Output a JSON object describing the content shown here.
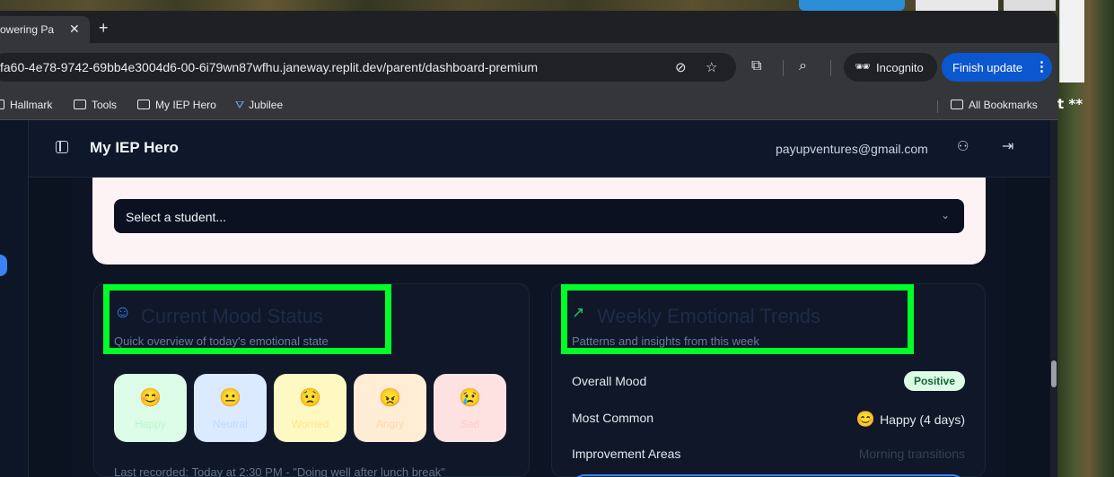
{
  "desktop": {
    "side_text": "t **"
  },
  "browser": {
    "tab": {
      "title": "owering Pa",
      "close": "✕",
      "new_tab": "+"
    },
    "url": "fa60-4e78-9742-69bb4e3004d6-00-6i79wn87wfhu.janeway.replit.dev/parent/dashboard-premium",
    "incognito_label": "Incognito",
    "finish_update_label": "Finish update",
    "bookmarks": [
      {
        "label": "Hallmark"
      },
      {
        "label": "Tools"
      },
      {
        "label": "My IEP Hero"
      },
      {
        "label": "Jubilee"
      }
    ],
    "all_bookmarks_label": "All Bookmarks"
  },
  "app": {
    "title": "My IEP Hero",
    "user_email": "payupventures@gmail.com",
    "student_select": {
      "placeholder": "Select a student..."
    },
    "mood_card": {
      "title": "Current Mood Status",
      "subtitle": "Quick overview of today's emotional state",
      "moods": [
        {
          "emoji": "😊",
          "label": "Happy",
          "bg": "#dcfce7",
          "fg": "#bbf7d0"
        },
        {
          "emoji": "😐",
          "label": "Neutral",
          "bg": "#dbeafe",
          "fg": "#bfdbfe"
        },
        {
          "emoji": "😟",
          "label": "Worried",
          "bg": "#fef9c3",
          "fg": "#fde68a"
        },
        {
          "emoji": "😠",
          "label": "Angry",
          "bg": "#ffedd5",
          "fg": "#fed7aa"
        },
        {
          "emoji": "😢",
          "label": "Sad",
          "bg": "#fee2e2",
          "fg": "#fecaca"
        }
      ],
      "last_recorded": "Last recorded: Today at 2:30 PM - \"Doing well after lunch break\""
    },
    "trends_card": {
      "title": "Weekly Emotional Trends",
      "subtitle": "Patterns and insights from this week",
      "overall_mood_label": "Overall Mood",
      "overall_mood_value": "Positive",
      "most_common_label": "Most Common",
      "most_common_emoji": "😊",
      "most_common_value": "Happy (4 days)",
      "improvement_label": "Improvement Areas",
      "improvement_value": "Morning transitions"
    }
  },
  "colors": {
    "highlight": "#00ff26",
    "accent_blue": "#3b82f6",
    "finish_button": "#0b57d0"
  }
}
